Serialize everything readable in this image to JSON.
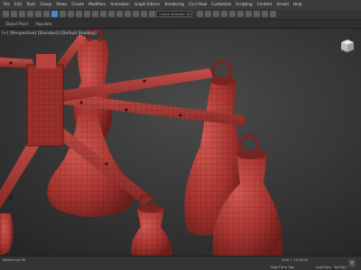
{
  "menu": {
    "items": [
      "File",
      "Edit",
      "Tools",
      "Group",
      "Views",
      "Create",
      "Modifiers",
      "Animation",
      "Graph Editors",
      "Rendering",
      "Civil View",
      "Customize",
      "Scripting",
      "Content",
      "Arnold",
      "Help"
    ]
  },
  "toolbar": {
    "selection_set": "Create Selection Se"
  },
  "ribbon": {
    "tabs": [
      "Object Paint",
      "Populate"
    ]
  },
  "viewport": {
    "label": "[+] [Perspective] [Standard] [Default Shading]"
  },
  "status": {
    "script_label": "MAXScript Mi",
    "add_time_tag": "Add Time Tag",
    "grid": "Grid = 10,0mm",
    "auto_key": "Auto Key",
    "set_key": "Set Key"
  },
  "colors": {
    "model": "#b23a36",
    "accent": "#4a88d6"
  }
}
